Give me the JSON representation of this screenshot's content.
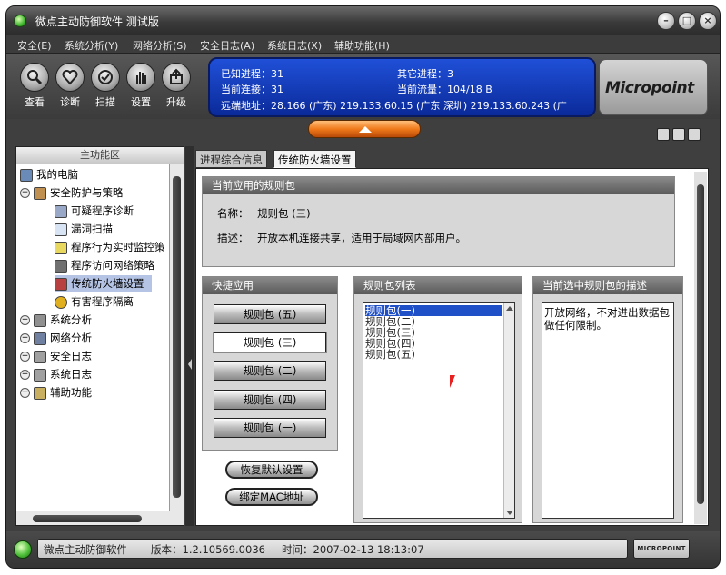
{
  "window": {
    "title": "微点主动防御软件  测试版",
    "controls": [
      "minimize-icon",
      "maximize-icon",
      "close-icon"
    ]
  },
  "menu": [
    "安全(E)",
    "系统分析(Y)",
    "网络分析(S)",
    "安全日志(A)",
    "系统日志(X)",
    "辅助功能(H)"
  ],
  "toolbar": [
    {
      "label": "查看",
      "icon": "magnifier-icon"
    },
    {
      "label": "诊断",
      "icon": "heart-icon"
    },
    {
      "label": "扫描",
      "icon": "scan-icon"
    },
    {
      "label": "设置",
      "icon": "hand-icon"
    },
    {
      "label": "升级",
      "icon": "upgrade-icon"
    }
  ],
  "info": {
    "known_processes": "已知进程：31",
    "other_processes": "其它进程：3",
    "current_connections": "当前连接：31",
    "current_traffic": "当前流量：104/18 B",
    "remote_address": "远端地址：28.166 (广东)   219.133.60.15 (广东 深圳)   219.133.60.243 (广"
  },
  "logo": "Micropoint",
  "left_panel": {
    "title": "主功能区",
    "tree": [
      {
        "label": "我的电脑",
        "level": 0
      },
      {
        "label": "安全防护与策略",
        "level": 1
      },
      {
        "label": "可疑程序诊断",
        "level": 2
      },
      {
        "label": "漏洞扫描",
        "level": 2
      },
      {
        "label": "程序行为实时监控策",
        "level": 2
      },
      {
        "label": "程序访问网络策略",
        "level": 2
      },
      {
        "label": "传统防火墙设置",
        "level": 2,
        "selected": true
      },
      {
        "label": "有害程序隔离",
        "level": 2
      },
      {
        "label": "系统分析",
        "level": 1
      },
      {
        "label": "网络分析",
        "level": 1
      },
      {
        "label": "安全日志",
        "level": 1
      },
      {
        "label": "系统日志",
        "level": 1
      },
      {
        "label": "辅助功能",
        "level": 1
      }
    ]
  },
  "tabs": [
    {
      "label": "进程综合信息",
      "active": false
    },
    {
      "label": "传统防火墙设置",
      "active": true
    }
  ],
  "current_rule": {
    "title": "当前应用的规则包",
    "name_label": "名称：",
    "name": "规则包 (三)",
    "desc_label": "描述：",
    "desc": "开放本机连接共享，适用于局域网内部用户。"
  },
  "quick_apply": {
    "title": "快捷应用",
    "buttons": [
      "规则包 (五)",
      "规则包 (三)",
      "规则包 (二)",
      "规则包 (四)",
      "规则包 (一)"
    ],
    "selected_index": 1,
    "restore_label": "恢复默认设置",
    "bind_mac_label": "绑定MAC地址"
  },
  "rule_list": {
    "title": "规则包列表",
    "items": [
      "规则包(一)",
      "规则包(二)",
      "规则包(三)",
      "规则包(四)",
      "规则包(五)"
    ],
    "selected_index": 0
  },
  "rule_desc": {
    "title": "当前选中规则包的描述",
    "text": "开放网络，不对进出数据包做任何限制。"
  },
  "status": {
    "app": "微点主动防御软件",
    "version": "版本：1.2.10569.0036",
    "time": "时间：2007-02-13 18:13:07",
    "logo": "MICROPOINT"
  },
  "colors": {
    "info_panel": "#1a44c8",
    "selection": "#2050c8",
    "tree_selection": "#b5c4e4",
    "expand_button": "#f07a1a"
  }
}
